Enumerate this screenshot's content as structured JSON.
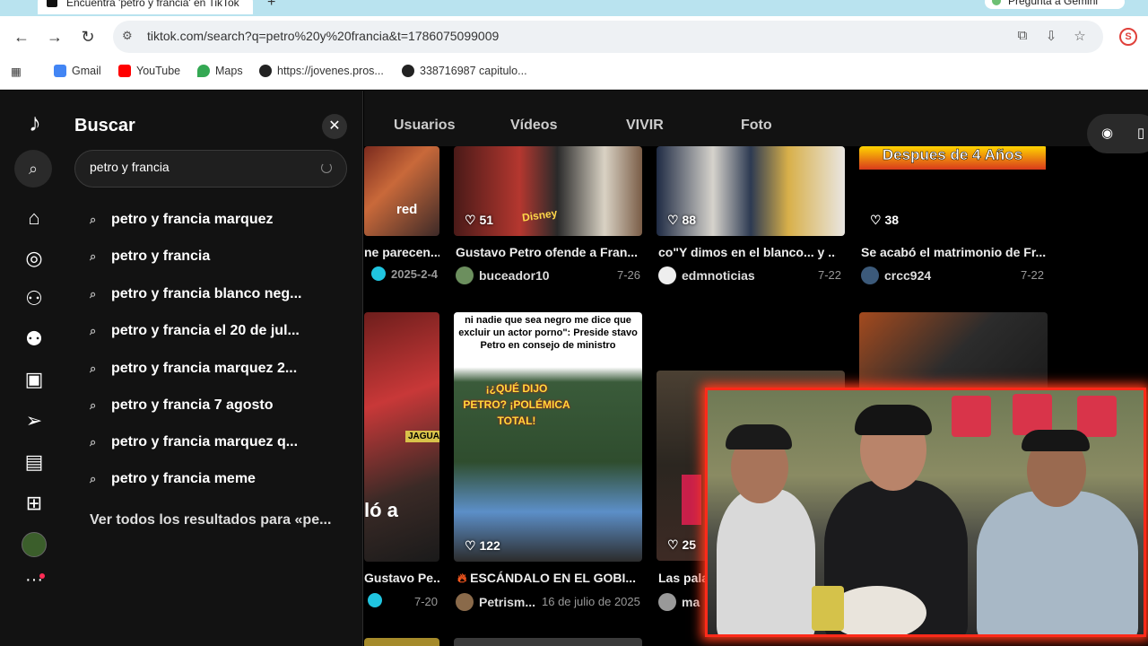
{
  "browser": {
    "tab_title": "Encuentra 'petro y francia' en TikTok",
    "new_tab": "+",
    "gemini_label": "Pregunta a Gemini",
    "url": "tiktok.com/search?q=petro%20y%20francia&t=1786075099009",
    "bookmarks": [
      {
        "label": "Gmail",
        "color": "#4285f4"
      },
      {
        "label": "YouTube",
        "color": "#ff0000"
      },
      {
        "label": "Maps",
        "color": "#34a853"
      },
      {
        "label": "https://jovenes.pros...",
        "color": "#222222"
      },
      {
        "label": "338716987 capitulo...",
        "color": "#222222"
      }
    ]
  },
  "search": {
    "title": "Buscar",
    "query": "petro y francia",
    "suggestions": [
      "petro y francia marquez",
      "petro y francia",
      "petro y francia blanco neg...",
      "petro y francia el 20 de jul...",
      "petro y francia marquez 2...",
      "petro y francia 7 agosto",
      "petro y francia marquez q...",
      "petro y francia meme"
    ],
    "see_all": "Ver todos los resultados para «pe..."
  },
  "tabs": [
    "Usuarios",
    "Vídeos",
    "VIVIR",
    "Foto"
  ],
  "results_row1": [
    {
      "title": "ne parecen...",
      "user": "",
      "date": "2025-2-4",
      "likes": "",
      "verified": true
    },
    {
      "title": "Gustavo Petro ofende a Fran...",
      "user": "buceador10",
      "date": "7-26",
      "likes": "51"
    },
    {
      "title": "co\"Y dimos en el blanco... y ...",
      "user": "edmnoticias",
      "date": "7-22",
      "likes": "88"
    },
    {
      "title": "Se acabó el matrimonio de Fr...",
      "user": "crcc924",
      "date": "7-22",
      "likes": "38"
    }
  ],
  "results_row2": [
    {
      "title": "Gustavo Pe...",
      "user": "",
      "date": "7-20",
      "likes": "",
      "verified": true
    },
    {
      "title": "ESCÁNDALO EN EL GOBI...",
      "user": "Petrism...",
      "date": "16 de julio de 2025",
      "likes": "122"
    },
    {
      "title": "Las pala",
      "user": "ma",
      "date": "",
      "likes": "25"
    }
  ],
  "thumb_text": {
    "red": "red",
    "disney": "Disney",
    "despues": "Despues de 4 Años",
    "quote": "ni nadie que sea negro me dice que excluir un actor porno\": Preside stavo Petro en consejo de ministro",
    "que_dijo": "¡¿QUÉ DIJO PETRO? ¡POLÉMICA TOTAL!",
    "lo_a": "ló a",
    "jaguar": "JAGUAR"
  },
  "colors": {
    "tiktok_red": "#fe2c55",
    "cam_border": "#ff2a1a",
    "panel_bg": "#121212"
  }
}
